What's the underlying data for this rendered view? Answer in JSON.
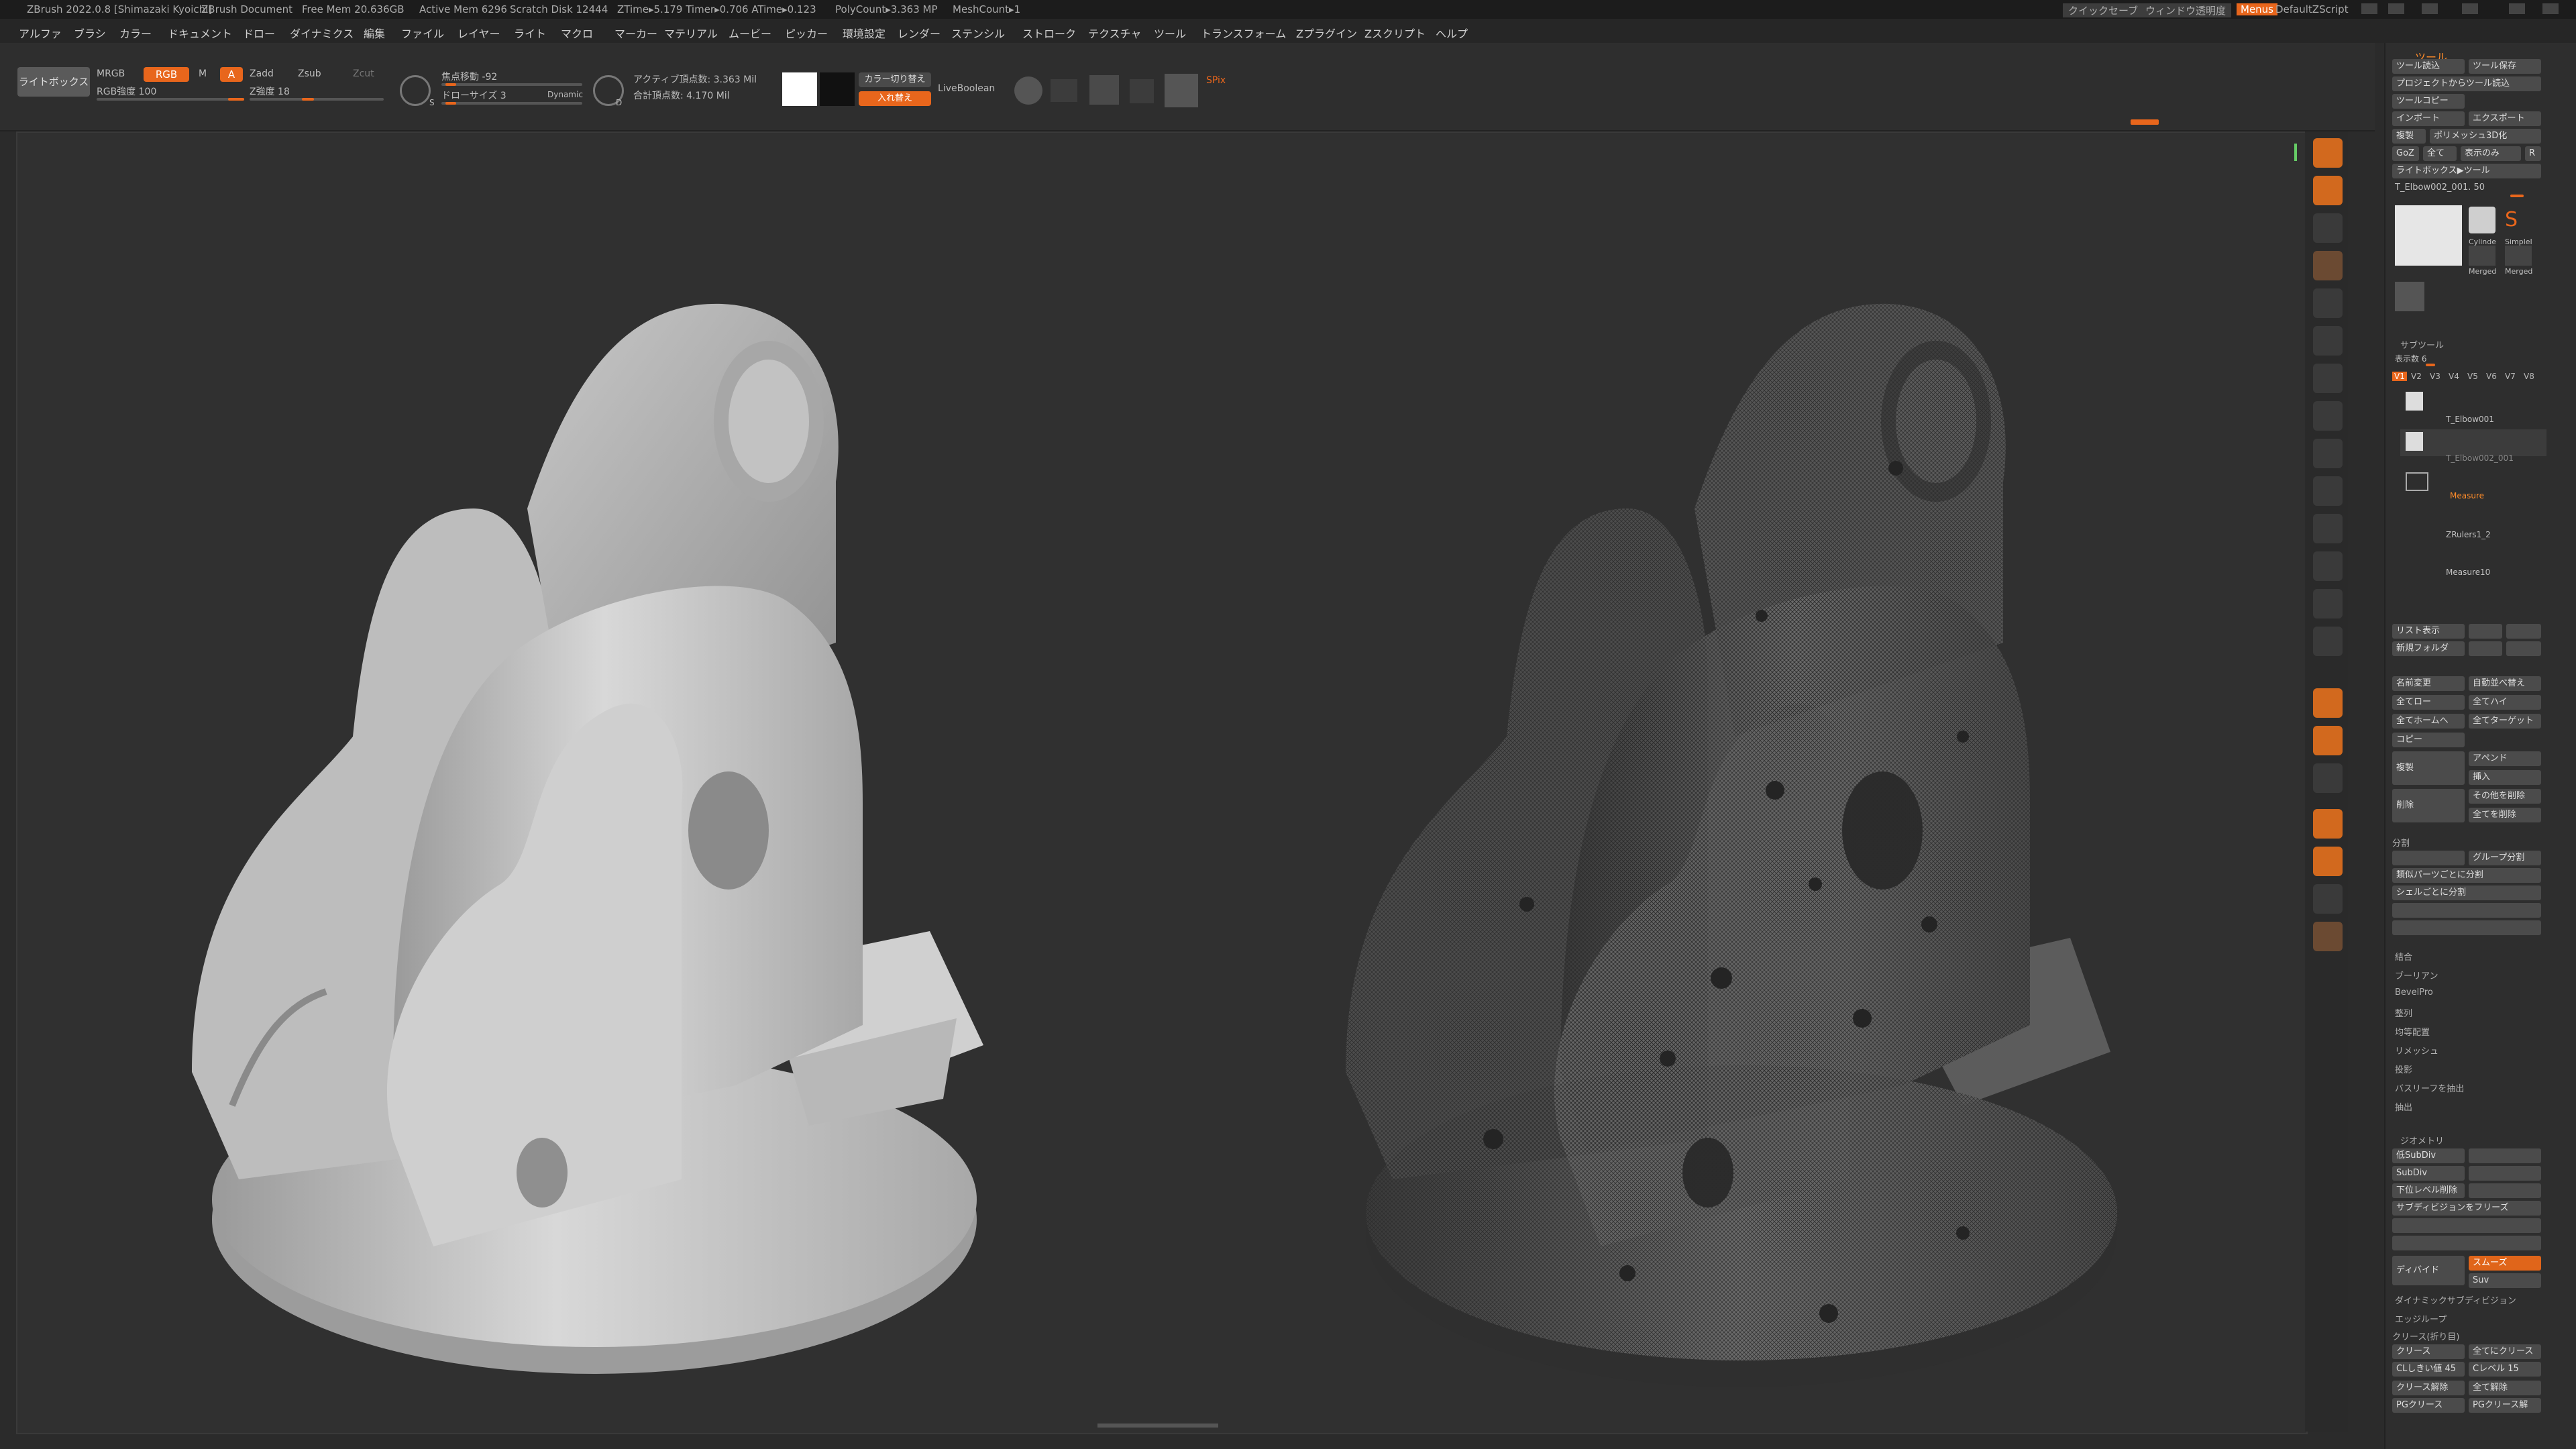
{
  "titlebar": {
    "app": "ZBrush 2022.0.8 [Shimazaki Kyoichi]",
    "doc": "ZBrush Document",
    "free_mem": "Free Mem 20.636GB",
    "active_mem": "Active Mem 6296",
    "scratch": "Scratch Disk 12444",
    "ztime": "ZTime▸5.179 Timer▸0.706 ATime▸0.123",
    "polycount": "PolyCount▸3.363 MP",
    "meshcount": "MeshCount▸1",
    "quicksave": "クイックセーブ",
    "transparency": "ウィンドウ透明度",
    "menus": "Menus",
    "script": "DefaultZScript"
  },
  "menubar": [
    "アルファ",
    "ブラシ",
    "カラー",
    "ドキュメント",
    "ドロー",
    "ダイナミクス",
    "編集",
    "ファイル",
    "レイヤー",
    "ライト",
    "マクロ",
    "マーカー",
    "マテリアル",
    "ムービー",
    "ピッカー",
    "環境設定",
    "レンダー",
    "ステンシル",
    "ストローク",
    "テクスチャ",
    "ツール",
    "トランスフォーム",
    "Zプラグイン",
    "Zスクリプト",
    "ヘルプ"
  ],
  "shelf": {
    "lightbox": "ライトボックス",
    "mrgb": "MRGB",
    "rgb": "RGB",
    "m": "M",
    "a": "A",
    "zadd": "Zadd",
    "zsub": "Zsub",
    "zcut": "Zcut",
    "rgb_intensity": "RGB強度 100",
    "z_intensity": "Z強度 18",
    "focal_shift": "焦点移動 -92",
    "draw_size": "ドローサイズ 3",
    "dynamic": "Dynamic",
    "active_points": "アクティブ頂点数: 3.363 Mil",
    "total_points": "合計頂点数: 4.170 Mil",
    "color_switch": "カラー切り替え",
    "swap": "入れ替え",
    "liveboolean": "LiveBoolean",
    "spix": "SPix",
    "s": "S",
    "d": "D"
  },
  "panel": {
    "title": "ツール",
    "load_tool": "ツール読込",
    "save_tool": "ツール保存",
    "load_from_project": "プロジェクトからツール読込",
    "copy_tool": "ツールコピー",
    "import": "インポート",
    "export": "エクスポート",
    "clone": "複製",
    "make_polymesh": "ポリメッシュ3D化",
    "goz": "GoZ",
    "all": "全て",
    "visible": "表示のみ",
    "r": "R",
    "lightbox_tool": "ライトボックス▶ツール",
    "tool_name": "T_Elbow002_001. 50",
    "thumb_labels": [
      "Cylinde",
      "SimpleI",
      "Merged",
      "Merged"
    ],
    "subtool_title": "サブツール",
    "visible_count": "表示数 6",
    "versions": [
      "V1",
      "V2",
      "V3",
      "V4",
      "V5",
      "V6",
      "V7",
      "V8"
    ],
    "subtools": [
      "T_Elbow001",
      "T_Elbow002_001",
      "Measure",
      "ZRulers1_2",
      "Measure10"
    ],
    "list_all": "リスト表示",
    "new_folder": "新規フォルダ",
    "rename": "名前変更",
    "auto_reorder": "自動並べ替え",
    "all_low": "全てロー",
    "all_high": "全てハイ",
    "all_to_home": "全てホームへ",
    "all_to_target": "全てターゲット",
    "copy": "コピー",
    "duplicate": "複製",
    "append": "アペンド",
    "insert": "挿入",
    "delete": "削除",
    "delete_other": "その他を削除",
    "delete_all": "全てを削除",
    "split": "分割",
    "group_split": "グループ分割",
    "split_similar": "類似パーツごとに分割",
    "split_shell": "シェルごとに分割",
    "merge": "結合",
    "boolean": "ブーリアン",
    "bevelpro": "BevelPro",
    "align": "整列",
    "distribute": "均等配置",
    "remesh": "リメッシュ",
    "project": "投影",
    "bas_relief": "バスリーフを抽出",
    "extract": "抽出",
    "geometry": "ジオメトリ",
    "lower_subdiv": "低SubDiv",
    "subdiv": "SubDiv",
    "delete_lower": "下位レベル削除",
    "freeze_subdiv": "サブディビジョンをフリーズ",
    "divide": "ディバイド",
    "smooth": "スムーズ",
    "suv": "Suv",
    "dynamic_subdiv": "ダイナミックサブディビジョン",
    "edge_loop": "エッジループ",
    "crease_title": "クリース(折り目)",
    "crease": "クリース",
    "crease_all": "全てにクリース",
    "crease_threshold": "CLしきい値 45",
    "crease_level": "Cレベル 15",
    "uncrease": "クリース解除",
    "uncrease_all": "全て解除",
    "pg_crease": "PGクリース",
    "pg_uncrease": "PGクリース解"
  },
  "iconcol": {
    "edit": "Edit",
    "draw": "Draw",
    "move": "移動",
    "scale": "スケール",
    "rotate": "回転",
    "polyf": "PolyF",
    "transp": "透明",
    "frame": "フレーム"
  },
  "colors": {
    "accent": "#e8661c",
    "bg": "#2b2b2b",
    "panel": "#2e2e2e"
  }
}
